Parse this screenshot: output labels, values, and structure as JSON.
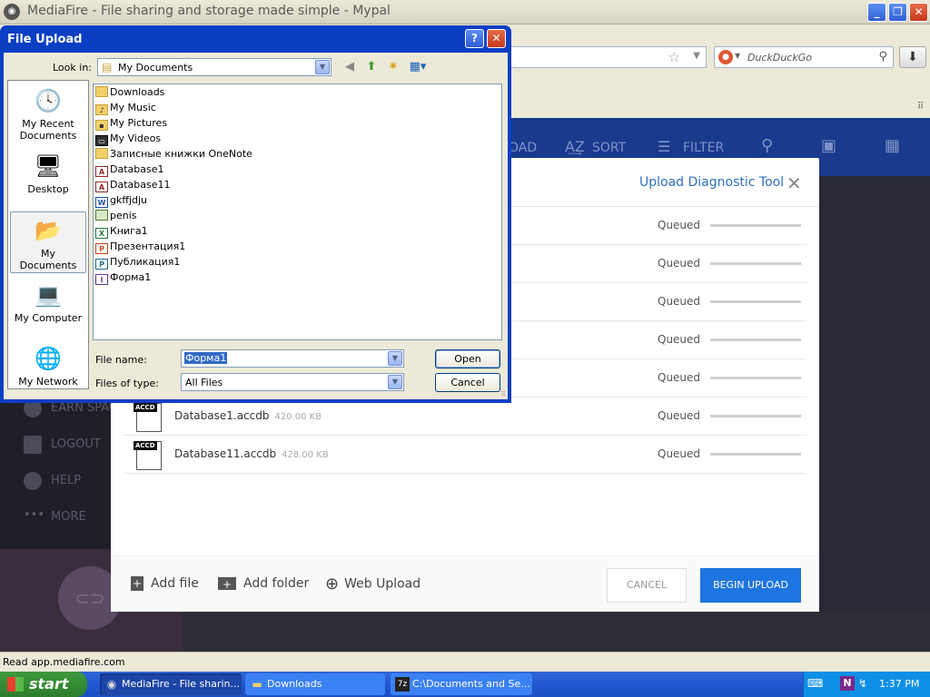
{
  "browser": {
    "title": "MediaFire - File sharing and storage made simple - Mypal",
    "search_placeholder": "DuckDuckGo",
    "status": "Read app.mediafire.com"
  },
  "mediafire": {
    "toolbar": [
      "OAD",
      "SORT",
      "FILTER"
    ],
    "sidebar": [
      "EARN SPAC",
      "LOGOUT",
      "HELP",
      "MORE"
    ]
  },
  "upload_modal": {
    "diagnostic_link": "Upload Diagnostic Tool",
    "rows": [
      {
        "status": "Queued"
      },
      {
        "status": "Queued"
      },
      {
        "status": "Queued"
      },
      {
        "status": "Queued"
      },
      {
        "status": "Queued"
      },
      {
        "name": "Database1.accdb",
        "size": "420.00 KB",
        "icon_tag": "ACCD",
        "status": "Queued"
      },
      {
        "name": "Database11.accdb",
        "size": "428.00 KB",
        "icon_tag": "ACCD",
        "status": "Queued"
      }
    ],
    "add_file": "Add file",
    "add_folder": "Add folder",
    "web_upload": "Web Upload",
    "cancel": "CANCEL",
    "begin_upload": "BEGIN UPLOAD"
  },
  "file_dialog": {
    "title": "File Upload",
    "look_in_label": "Look in:",
    "look_in_value": "My Documents",
    "places": [
      {
        "label": "My Recent Documents",
        "icon": "recent-documents-icon"
      },
      {
        "label": "Desktop",
        "icon": "desktop-icon"
      },
      {
        "label": "My Documents",
        "icon": "my-documents-icon"
      },
      {
        "label": "My Computer",
        "icon": "my-computer-icon"
      },
      {
        "label": "My Network",
        "icon": "my-network-icon"
      }
    ],
    "files": [
      {
        "name": "Downloads",
        "icon": "folder-icon"
      },
      {
        "name": "My Music",
        "icon": "music-folder-icon"
      },
      {
        "name": "My Pictures",
        "icon": "pictures-folder-icon"
      },
      {
        "name": "My Videos",
        "icon": "videos-folder-icon"
      },
      {
        "name": "Записные книжки OneNote",
        "icon": "folder-icon"
      },
      {
        "name": "Database1",
        "icon": "access-file-icon"
      },
      {
        "name": "Database11",
        "icon": "access-file-icon"
      },
      {
        "name": "gkffjdju",
        "icon": "word-file-icon"
      },
      {
        "name": "penis",
        "icon": "image-file-icon"
      },
      {
        "name": "Книга1",
        "icon": "excel-file-icon"
      },
      {
        "name": "Презентация1",
        "icon": "powerpoint-file-icon"
      },
      {
        "name": "Публикация1",
        "icon": "publisher-file-icon"
      },
      {
        "name": "Форма1",
        "icon": "infopath-file-icon"
      }
    ],
    "file_name_label": "File name:",
    "file_name_value": "Форма1",
    "file_type_label": "Files of type:",
    "file_type_value": "All Files",
    "open": "Open",
    "cancel": "Cancel"
  },
  "taskbar": {
    "start": "start",
    "tasks": [
      "MediaFire - File sharin...",
      "Downloads",
      "C:\\Documents and Se..."
    ],
    "clock": "1:37 PM"
  }
}
